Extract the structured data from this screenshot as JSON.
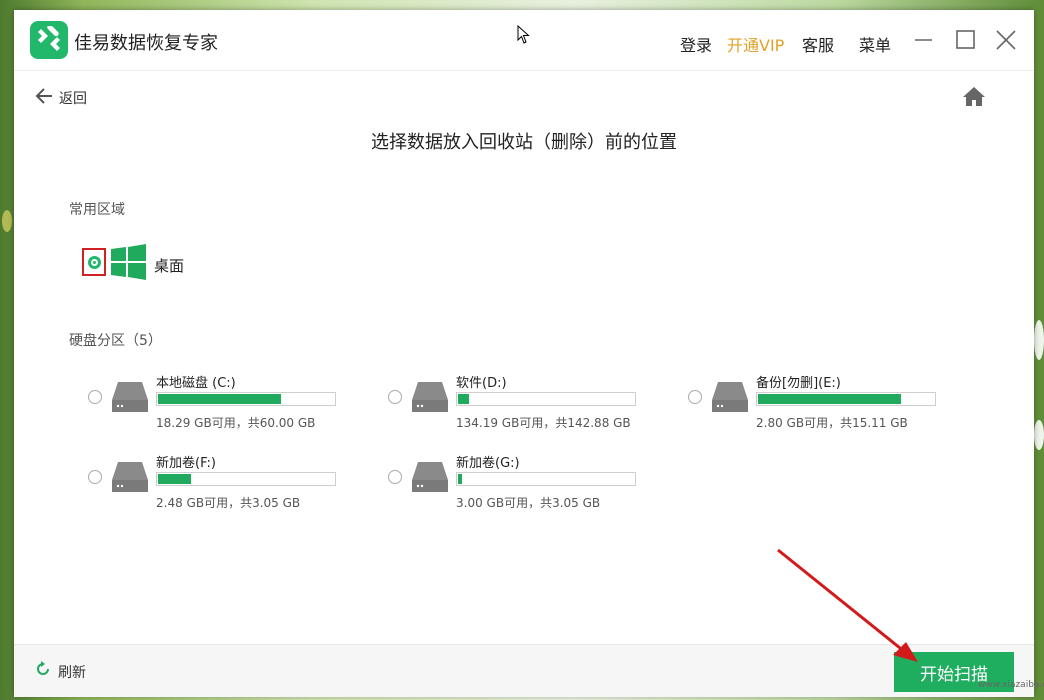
{
  "window": {
    "app_title": "佳易数据恢复专家",
    "nav_links": {
      "login": "登录",
      "vip": "开通VIP",
      "support": "客服",
      "menu": "菜单"
    }
  },
  "nav": {
    "back_label": "返回"
  },
  "page_title": "选择数据放入回收站（删除）前的位置",
  "common_area": {
    "label": "常用区域",
    "desktop_label": "桌面",
    "desktop_selected": true
  },
  "partitions": {
    "label": "硬盘分区（5）",
    "drives": [
      {
        "name": "本地磁盘 (C:)",
        "info": "18.29 GB可用，共60.00 GB",
        "used_fraction": 0.7
      },
      {
        "name": "软件(D:)",
        "info": "134.19 GB可用，共142.88 GB",
        "used_fraction": 0.06
      },
      {
        "name": "备份[勿删](E:)",
        "info": "2.80 GB可用，共15.11 GB",
        "used_fraction": 0.81
      },
      {
        "name": "新加卷(F:)",
        "info": "2.48 GB可用，共3.05 GB",
        "used_fraction": 0.19
      },
      {
        "name": "新加卷(G:)",
        "info": "3.00 GB可用，共3.05 GB",
        "used_fraction": 0.02
      }
    ]
  },
  "footer": {
    "refresh_label": "刷新",
    "start_label": "开始扫描"
  },
  "colors": {
    "accent": "#1fae5f",
    "vip": "#e0a32a",
    "highlight_box": "#d0201f"
  },
  "watermark": "www.xiazaiba.com"
}
